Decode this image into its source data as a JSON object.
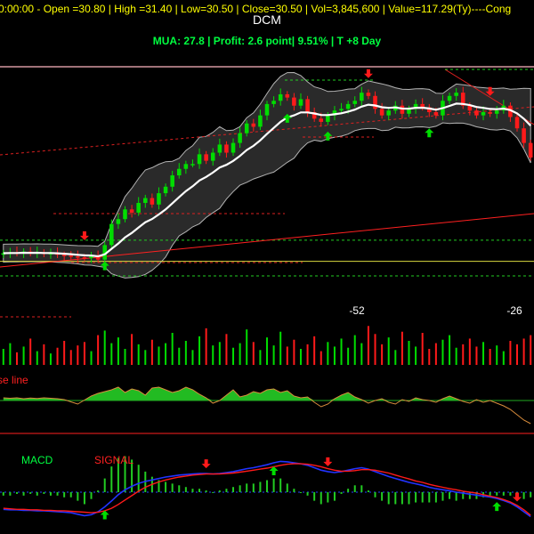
{
  "header": {
    "quote_line": "0:00:00 - Open =30.80 | High =31.40 | Low=30.50 | Close=30.50 | Vol=3,845,600 | Value=117.29(Ty)----Cong",
    "symbol": "DCM",
    "signal_info": "MUA: 27.8 | Profit: 2.6 point| 9.51% | T +8 Day"
  },
  "labels": {
    "count_left": "-52",
    "count_right": "-26",
    "base_line": "se line",
    "macd": "MACD",
    "signal": "SIGNAL"
  },
  "colors": {
    "background": "#000000",
    "up": "#00dd00",
    "down": "#ff1a1a",
    "band": "#b4b4b4",
    "middle_line": "#ffffff",
    "macd_line": "#2233ff",
    "signal_line": "#ff1a1a",
    "oscillator_fill": "#22bb22",
    "oscillator_line": "#d88c3c"
  },
  "chart_data": {
    "type": "candlestick",
    "symbol": "DCM",
    "panels": [
      "price",
      "volume",
      "oscillator",
      "macd"
    ],
    "price": {
      "close": [
        20.5,
        20.55,
        20.5,
        20.6,
        20.5,
        20.55,
        20.45,
        20.5,
        20.4,
        20.35,
        20.3,
        20.25,
        20.2,
        20.3,
        20.1,
        21.0,
        22.3,
        22.6,
        23.2,
        23.0,
        23.6,
        23.9,
        23.5,
        24.2,
        24.6,
        25.3,
        25.7,
        26.0,
        26.0,
        26.6,
        26.2,
        26.7,
        27.2,
        26.7,
        27.3,
        27.9,
        28.5,
        28.3,
        29.0,
        29.7,
        29.9,
        30.3,
        30.1,
        29.6,
        30.0,
        29.2,
        28.8,
        28.6,
        29.0,
        29.3,
        29.4,
        29.7,
        29.9,
        30.4,
        30.2,
        29.4,
        29.0,
        29.3,
        29.6,
        29.1,
        29.4,
        29.7,
        29.5,
        29.2,
        29.0,
        29.9,
        30.2,
        30.4,
        29.6,
        29.3,
        29.0,
        29.2,
        29.1,
        29.3,
        29.6,
        28.9,
        28.2,
        27.3,
        26.4
      ],
      "middle_band_start": 20.5,
      "buy_signal_indices": [
        15,
        42,
        48,
        63
      ],
      "sell_signal_indices": [
        12,
        54,
        72
      ],
      "support_levels": [
        20.0,
        21.3,
        19.1
      ]
    },
    "volume": {
      "values": [
        1.4,
        1.9,
        1.1,
        1.6,
        2.3,
        1.2,
        1.8,
        1.0,
        1.5,
        2.1,
        1.3,
        1.7,
        2.0,
        1.2,
        2.6,
        3.0,
        1.9,
        2.4,
        1.4,
        2.7,
        1.8,
        1.3,
        2.2,
        1.6,
        1.9,
        2.8,
        1.5,
        2.1,
        1.3,
        2.5,
        3.2,
        1.7,
        2.0,
        2.7,
        1.5,
        1.9,
        3.1,
        2.0,
        1.3,
        2.4,
        1.7,
        2.9,
        1.6,
        2.2,
        1.4,
        1.8,
        2.5,
        1.2,
        2.0,
        1.6,
        2.3,
        1.5,
        2.6,
        1.9,
        3.4,
        2.7,
        1.8,
        2.4,
        1.3,
        2.9,
        2.1,
        1.6,
        2.8,
        1.4,
        1.9,
        2.2,
        2.6,
        1.5,
        1.8,
        2.3,
        1.6,
        2.0,
        1.4,
        1.7,
        1.2,
        2.1,
        1.8,
        2.3,
        2.6
      ],
      "count_labels": [
        "-52",
        "-26"
      ]
    },
    "oscillator": {
      "values": [
        0.3,
        0.25,
        0.3,
        0.2,
        0.28,
        0.22,
        0.3,
        0.25,
        0.2,
        0.1,
        -0.15,
        -0.4,
        0.05,
        0.5,
        0.8,
        1.0,
        1.2,
        1.5,
        0.9,
        1.3,
        1.1,
        0.6,
        1.4,
        1.5,
        1.2,
        0.9,
        1.1,
        1.5,
        1.2,
        0.7,
        0.3,
        -0.3,
        0.0,
        0.6,
        1.2,
        0.4,
        0.6,
        1.0,
        0.8,
        1.2,
        1.3,
        0.9,
        1.1,
        0.5,
        0.3,
        0.4,
        -0.2,
        -0.7,
        -0.4,
        0.2,
        0.6,
        0.9,
        0.4,
        0.1,
        -0.3,
        0.0,
        0.2,
        -0.2,
        -0.4,
        0.1,
        -0.1,
        0.3,
        0.1,
        0.0,
        -0.2,
        0.2,
        0.5,
        0.2,
        -0.1,
        -0.3,
        0.1,
        -0.2,
        0.0,
        -0.3,
        -0.6,
        -1.0,
        -1.6,
        -2.2,
        -2.6
      ],
      "label": "se line"
    },
    "macd": {
      "series": [
        {
          "name": "MACD",
          "values": [
            -0.35,
            -0.36,
            -0.36,
            -0.37,
            -0.37,
            -0.38,
            -0.38,
            -0.39,
            -0.4,
            -0.41,
            -0.42,
            -0.45,
            -0.48,
            -0.46,
            -0.4,
            -0.3,
            -0.18,
            -0.05,
            0.05,
            0.12,
            0.18,
            0.22,
            0.25,
            0.28,
            0.31,
            0.33,
            0.35,
            0.36,
            0.37,
            0.38,
            0.38,
            0.37,
            0.38,
            0.4,
            0.42,
            0.45,
            0.48,
            0.5,
            0.53,
            0.56,
            0.6,
            0.63,
            0.62,
            0.6,
            0.58,
            0.55,
            0.5,
            0.45,
            0.42,
            0.4,
            0.42,
            0.45,
            0.48,
            0.5,
            0.47,
            0.42,
            0.37,
            0.32,
            0.28,
            0.24,
            0.2,
            0.17,
            0.14,
            0.1,
            0.07,
            0.05,
            0.03,
            0.0,
            -0.02,
            -0.04,
            -0.06,
            -0.08,
            -0.1,
            -0.13,
            -0.17,
            -0.22,
            -0.3,
            -0.4,
            -0.5
          ]
        },
        {
          "name": "SIGNAL",
          "values": [
            -0.33,
            -0.34,
            -0.35,
            -0.35,
            -0.36,
            -0.36,
            -0.37,
            -0.37,
            -0.38,
            -0.38,
            -0.39,
            -0.4,
            -0.41,
            -0.42,
            -0.41,
            -0.38,
            -0.33,
            -0.25,
            -0.16,
            -0.07,
            0.02,
            0.1,
            0.16,
            0.21,
            0.25,
            0.28,
            0.31,
            0.33,
            0.35,
            0.36,
            0.37,
            0.37,
            0.37,
            0.38,
            0.39,
            0.41,
            0.43,
            0.45,
            0.47,
            0.49,
            0.52,
            0.55,
            0.57,
            0.58,
            0.58,
            0.57,
            0.55,
            0.52,
            0.48,
            0.45,
            0.43,
            0.43,
            0.44,
            0.46,
            0.46,
            0.45,
            0.42,
            0.39,
            0.35,
            0.31,
            0.27,
            0.23,
            0.2,
            0.16,
            0.13,
            0.1,
            0.07,
            0.05,
            0.02,
            0.0,
            -0.02,
            -0.05,
            -0.08,
            -0.11,
            -0.15,
            -0.2,
            -0.27,
            -0.36,
            -0.47
          ]
        }
      ],
      "buy_signal_indices": [
        15,
        40,
        73
      ],
      "sell_signal_indices": [
        30,
        48,
        76
      ]
    }
  }
}
